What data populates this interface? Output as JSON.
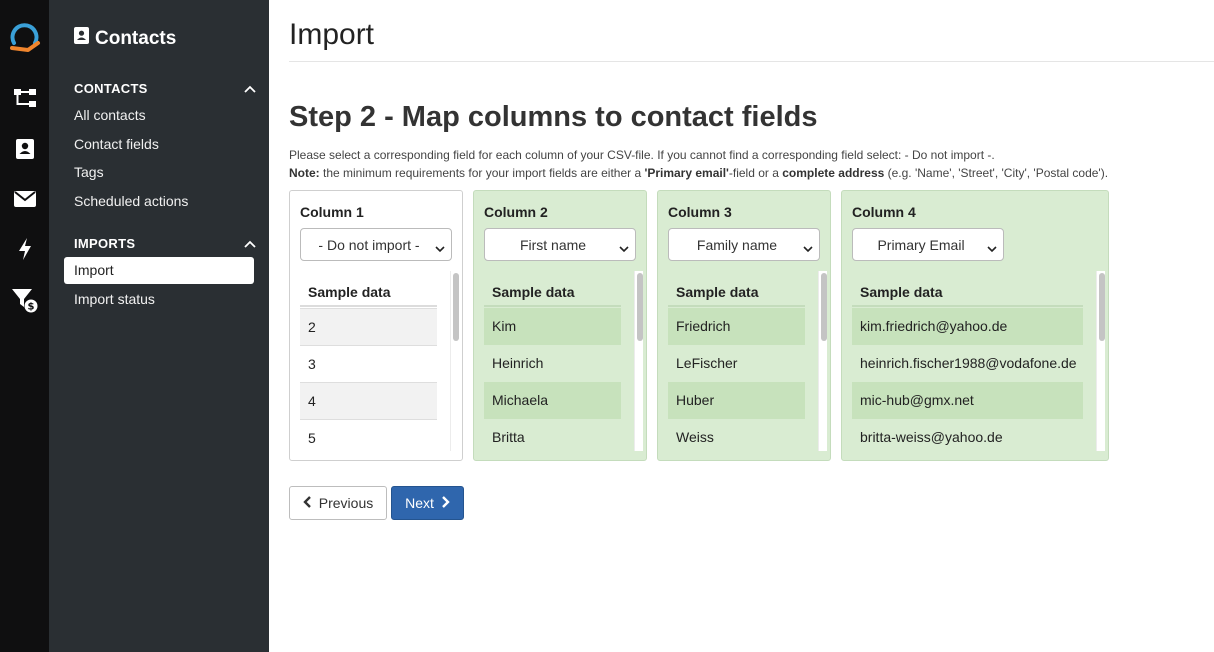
{
  "rail": {
    "icons": [
      "logo-icon",
      "workflow-icon",
      "contacts-icon",
      "mail-icon",
      "bolt-icon",
      "funnel-dollar-icon"
    ],
    "accent": "#f0852d",
    "logo_color": "#3aa0d8"
  },
  "sidebar": {
    "title": "Contacts",
    "sections": [
      {
        "label": "CONTACTS",
        "items": [
          "All contacts",
          "Contact fields",
          "Tags",
          "Scheduled actions"
        ]
      },
      {
        "label": "IMPORTS",
        "items": [
          "Import",
          "Import status"
        ]
      }
    ],
    "active_item": "Import"
  },
  "main": {
    "page_title": "Import",
    "step_title": "Step 2 - Map columns to contact fields",
    "help_line1": "Please select a corresponding field for each column of your CSV-file. If you cannot find a corresponding field select: - Do not import -.",
    "help_note_label": "Note:",
    "help_note_text1": " the minimum requirements for your import fields are either a ",
    "help_note_bold1": "'Primary email'",
    "help_note_text2": "-field or a ",
    "help_note_bold2": "complete address",
    "help_note_text3": " (e.g. 'Name', 'Street', 'City', 'Postal code').",
    "sample_header": "Sample data",
    "columns": [
      {
        "title": "Column 1",
        "selected": "- Do not import -",
        "mapped": false,
        "samples": [
          "2",
          "3",
          "4",
          "5"
        ]
      },
      {
        "title": "Column 2",
        "selected": "First name",
        "mapped": true,
        "samples": [
          "Kim",
          "Heinrich",
          "Michaela",
          "Britta"
        ]
      },
      {
        "title": "Column 3",
        "selected": "Family name",
        "mapped": true,
        "samples": [
          "Friedrich",
          "LeFischer",
          "Huber",
          "Weiss"
        ]
      },
      {
        "title": "Column 4",
        "selected": "Primary Email",
        "mapped": true,
        "samples": [
          "kim.friedrich@yahoo.de",
          "heinrich.fischer1988@vodafone.de",
          "mic-hub@gmx.net",
          "britta-weiss@yahoo.de"
        ]
      }
    ],
    "prev_label": "Previous",
    "next_label": "Next",
    "colors": {
      "mapped_bg": "#d9ecd2",
      "next_btn": "#2f66ad"
    }
  }
}
